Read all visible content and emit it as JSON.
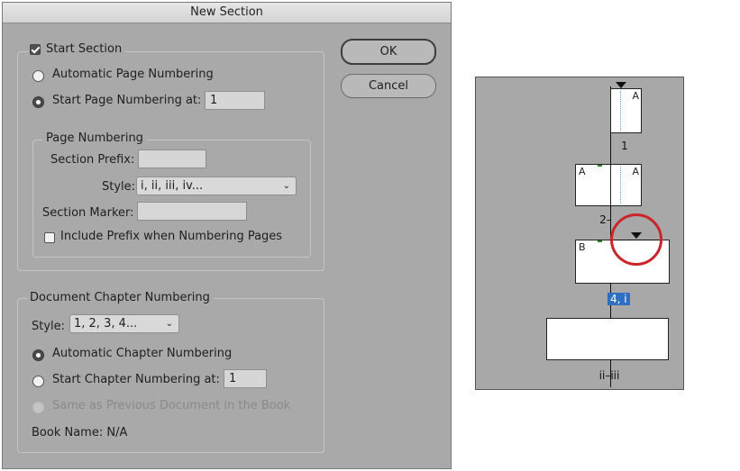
{
  "dialog": {
    "title": "New Section",
    "start_section": {
      "label": "Start Section",
      "checked": true
    },
    "auto_page_numbering": {
      "label": "Automatic Page Numbering",
      "selected": false
    },
    "start_page_numbering": {
      "label": "Start Page Numbering at:",
      "selected": true,
      "value": "1"
    },
    "page_numbering": {
      "legend": "Page Numbering",
      "section_prefix_label": "Section Prefix:",
      "section_prefix_value": "",
      "style_label": "Style:",
      "style_value": "i, ii, iii, iv...",
      "section_marker_label": "Section Marker:",
      "section_marker_value": "",
      "include_prefix_label": "Include Prefix when Numbering Pages",
      "include_prefix_checked": false
    },
    "chapter": {
      "legend": "Document Chapter Numbering",
      "style_label": "Style:",
      "style_value": "1, 2, 3, 4...",
      "auto_label": "Automatic Chapter Numbering",
      "auto_selected": true,
      "start_label": "Start Chapter Numbering at:",
      "start_value": "1",
      "same_as_prev_label": "Same as Previous Document in the Book",
      "book_name": "Book Name: N/A"
    },
    "ok_label": "OK",
    "cancel_label": "Cancel"
  },
  "pages_panel": {
    "captions": [
      "1",
      "2–",
      "4, i",
      "ii–iii"
    ],
    "master_letters": [
      "A",
      "A",
      "A",
      "B"
    ],
    "highlight_color": "#2e6fc1",
    "circle_color": "#c9252b"
  }
}
